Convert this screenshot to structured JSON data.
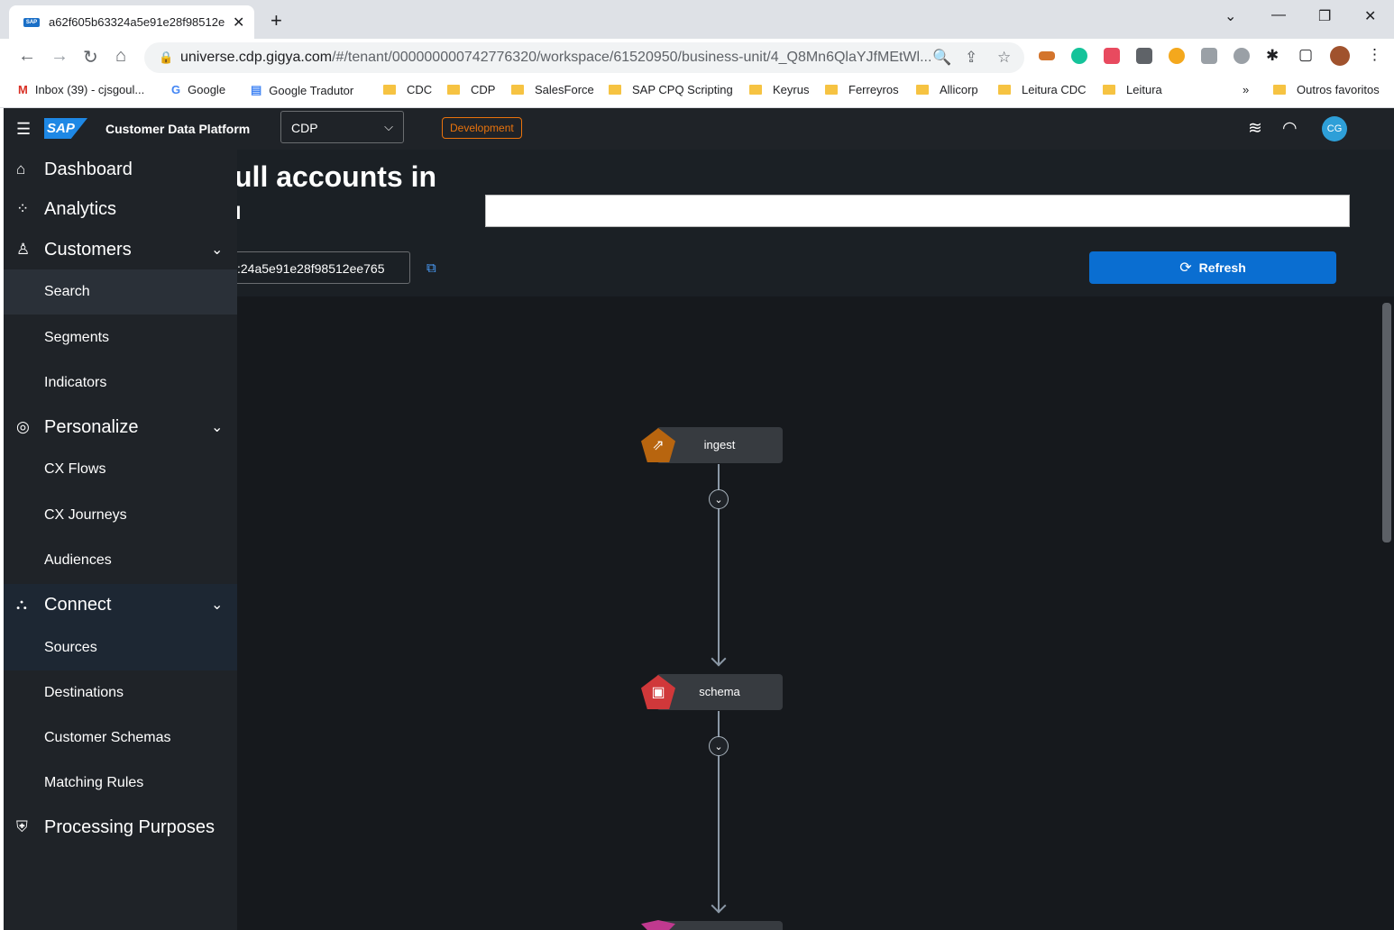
{
  "browser": {
    "tab_title": "a62f605b63324a5e91e28f98512e",
    "tab_favicon_text": "SAP",
    "url_host": "universe.cdp.gigya.com",
    "url_path": "/#/tenant/000000000742776320/workspace/61520950/business-unit/4_Q8Mn6QlaYJfMEtWl...",
    "bookmarks": [
      {
        "label": "Inbox (39) - cjsgoul...",
        "icon": "gmail-icon"
      },
      {
        "label": "Google",
        "icon": "google-icon"
      },
      {
        "label": "Google Tradutor",
        "icon": "translate-icon"
      },
      {
        "label": "CDC",
        "icon": "folder-icon"
      },
      {
        "label": "CDP",
        "icon": "folder-icon"
      },
      {
        "label": "SalesForce",
        "icon": "folder-icon"
      },
      {
        "label": "SAP CPQ Scripting",
        "icon": "folder-icon"
      },
      {
        "label": "Keyrus",
        "icon": "folder-icon"
      },
      {
        "label": "Ferreyros",
        "icon": "folder-icon"
      },
      {
        "label": "Allicorp",
        "icon": "folder-icon"
      },
      {
        "label": "Leitura CDC",
        "icon": "folder-icon"
      },
      {
        "label": "Leitura",
        "icon": "folder-icon"
      }
    ],
    "bookmarks_overflow": "»",
    "other_bookmarks": "Outros favoritos"
  },
  "shell": {
    "logo": "SAP",
    "product": "Customer Data Platform",
    "workspace": "CDP",
    "environment": "Development",
    "avatar": "CG"
  },
  "page": {
    "title_line1": "ull accounts in",
    "title_line2": "ı",
    "id_value": ":24a5e91e28f98512ee765",
    "refresh_label": "Refresh"
  },
  "sidenav": {
    "items": [
      {
        "label": "Dashboard"
      },
      {
        "label": "Analytics"
      },
      {
        "label": "Customers"
      },
      {
        "label": "Search"
      },
      {
        "label": "Segments"
      },
      {
        "label": "Indicators"
      },
      {
        "label": "Personalize"
      },
      {
        "label": "CX Flows"
      },
      {
        "label": "CX Journeys"
      },
      {
        "label": "Audiences"
      },
      {
        "label": "Connect"
      },
      {
        "label": "Sources"
      },
      {
        "label": "Destinations"
      },
      {
        "label": "Customer Schemas"
      },
      {
        "label": "Matching Rules"
      },
      {
        "label": "Processing Purposes"
      }
    ]
  },
  "flow": {
    "nodes": [
      {
        "label": "ingest",
        "color": "#b8650f",
        "icon": "share-icon"
      },
      {
        "label": "schema",
        "color": "#d0383a",
        "icon": "clipboard-icon"
      },
      {
        "label": "",
        "color": "#c0398f",
        "icon": "node-icon"
      }
    ]
  }
}
